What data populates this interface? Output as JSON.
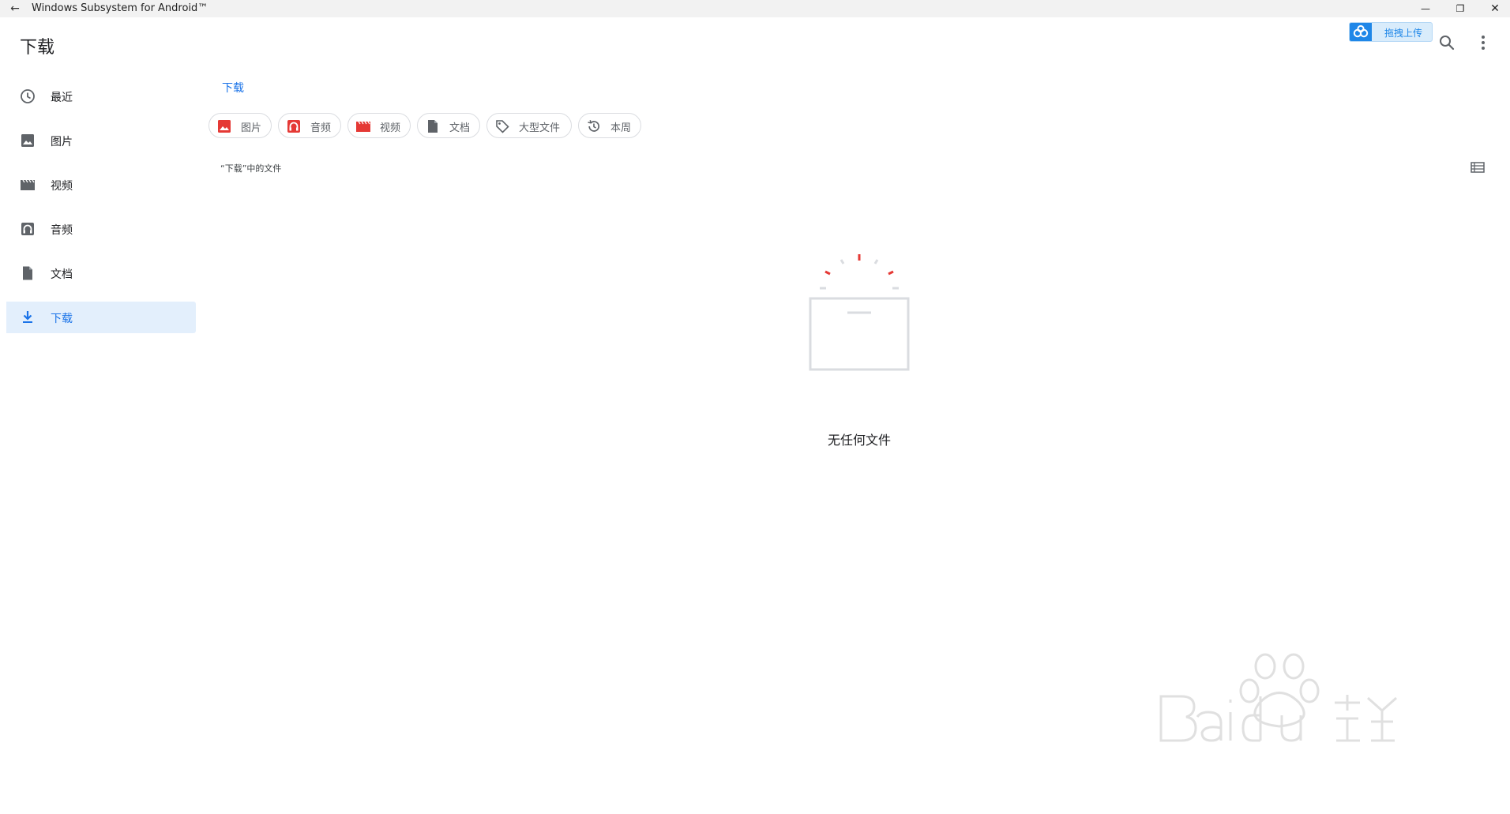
{
  "window": {
    "title": "Windows Subsystem for Android™",
    "back_glyph": "←",
    "minimize_glyph": "—",
    "maximize_glyph": "❐",
    "close_glyph": "✕"
  },
  "header": {
    "title": "下载",
    "upload_button_label": "拖拽上传",
    "accent_color": "#1a73e8"
  },
  "sidebar": {
    "items": [
      {
        "label": "最近",
        "icon": "clock-icon"
      },
      {
        "label": "图片",
        "icon": "image-icon"
      },
      {
        "label": "视频",
        "icon": "video-icon"
      },
      {
        "label": "音频",
        "icon": "audio-icon"
      },
      {
        "label": "文档",
        "icon": "document-icon"
      },
      {
        "label": "下载",
        "icon": "download-icon",
        "active": true
      }
    ]
  },
  "breadcrumb": "下载",
  "chips": [
    {
      "label": "图片",
      "icon": "image-icon"
    },
    {
      "label": "音频",
      "icon": "audio-icon"
    },
    {
      "label": "视频",
      "icon": "video-icon"
    },
    {
      "label": "文档",
      "icon": "document-icon"
    },
    {
      "label": "大型文件",
      "icon": "tag-icon"
    },
    {
      "label": "本周",
      "icon": "history-icon"
    }
  ],
  "section_label": "“下载”中的文件",
  "empty_state": {
    "message": "无任何文件"
  }
}
